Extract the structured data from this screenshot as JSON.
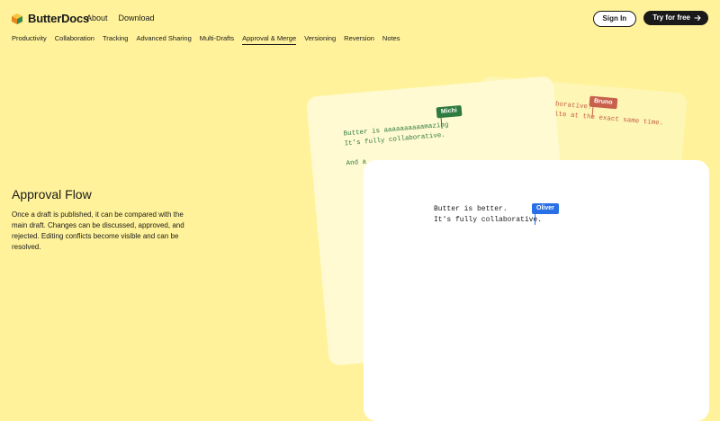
{
  "header": {
    "brand": "ButterDocs",
    "links": [
      "About",
      "Download"
    ],
    "signin_label": "Sign In",
    "try_label": "Try for free"
  },
  "tabs": [
    {
      "label": "Productivity",
      "active": false
    },
    {
      "label": "Collaboration",
      "active": false
    },
    {
      "label": "Tracking",
      "active": false
    },
    {
      "label": "Advanced Sharing",
      "active": false
    },
    {
      "label": "Multi-Drafts",
      "active": false
    },
    {
      "label": "Approval & Merge",
      "active": true
    },
    {
      "label": "Versioning",
      "active": false
    },
    {
      "label": "Reversion",
      "active": false
    },
    {
      "label": "Notes",
      "active": false
    }
  ],
  "hero": {
    "title": "Approval Flow",
    "description": "Once a draft is published, it can be compared with the main draft. Changes can be discussed, approved, and rejected. Editing conflicts become visible and can be resolved."
  },
  "cards": {
    "back": {
      "user": "Bruno",
      "lines": [
        "Butter is collaborative.",
        "You can even write at the exact same time."
      ]
    },
    "mid": {
      "user": "Michi",
      "lines": [
        "Butter is aaaaaaaaaamazing",
        "It's fully collaborative.",
        "",
        "And a"
      ]
    },
    "front": {
      "user": "Oliver",
      "lines": [
        "Butter is better.",
        "It's fully collaborative."
      ]
    }
  },
  "colors": {
    "background": "#FFF29A",
    "bruno": "#C8614C",
    "michi": "#2F7A3E",
    "oliver": "#2970E6"
  }
}
